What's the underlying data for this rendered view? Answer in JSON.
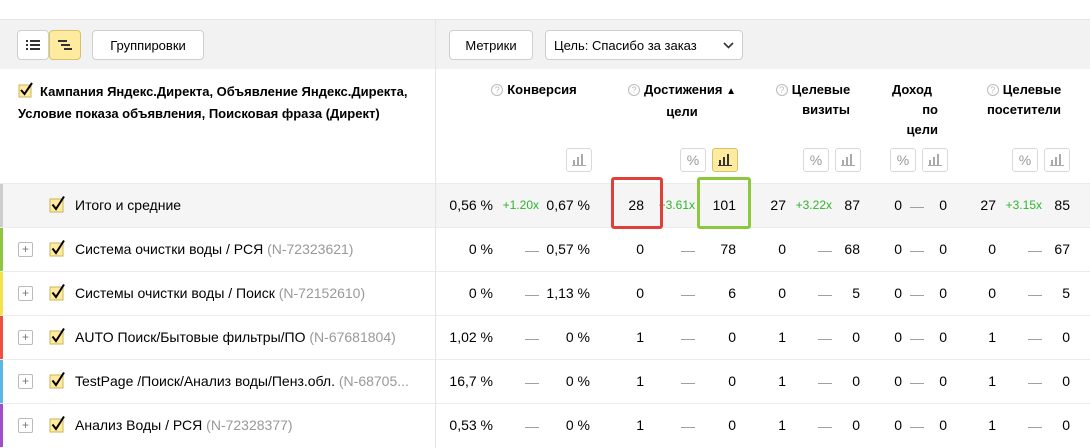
{
  "toolbar": {
    "view_list_icon": "list-view-icon",
    "view_tree_icon": "tree-view-icon",
    "groupings_label": "Группировки",
    "metrics_label": "Метрики",
    "goal_label": "Цель: Спасибо за заказ"
  },
  "header": {
    "main_title": "Кампания Яндекс.Директа, Объявление Яндекс.Директа, Условие показа объявления, Поисковая фраза (Директ)",
    "columns": {
      "conversion": "Конверсия",
      "goal_reaches_1": "Достижения",
      "goal_reaches_2": "цели",
      "sort_arrow": "▲",
      "target_visits_1": "Целевые",
      "target_visits_2": "визиты",
      "revenue_1": "Доход",
      "revenue_2": "по",
      "revenue_3": "цели",
      "target_visitors_1": "Целевые",
      "target_visitors_2": "посетители"
    }
  },
  "colors": {
    "accent_yellow": "#ffeba0",
    "delta_green": "#2db52d",
    "highlight_red": "#e0403a",
    "highlight_green": "#8dc63f"
  },
  "rows": [
    {
      "title": "Итого и средние",
      "id": "",
      "stripe": "#cccccc",
      "conv_a": "0,56 %",
      "conv_delta": "+1.20x",
      "conv_b": "0,67 %",
      "reach_a": "28",
      "reach_delta": "+3.61x",
      "reach_b": "101",
      "visits_a": "27",
      "visits_delta": "+3.22x",
      "visits_b": "87",
      "rev_a": "0",
      "rev_delta": "—",
      "rev_b": "0",
      "vis_a": "27",
      "vis_delta": "+3.15x",
      "vis_b": "85"
    },
    {
      "title": "Система очистки воды / РСЯ",
      "id": "(N-72323621)",
      "stripe": "#8dc63f",
      "conv_a": "0 %",
      "conv_delta": "—",
      "conv_b": "0,57 %",
      "reach_a": "0",
      "reach_delta": "—",
      "reach_b": "78",
      "visits_a": "0",
      "visits_delta": "—",
      "visits_b": "68",
      "rev_a": "0",
      "rev_delta": "—",
      "rev_b": "0",
      "vis_a": "0",
      "vis_delta": "—",
      "vis_b": "67"
    },
    {
      "title": "Системы очистки воды / Поиск",
      "id": "(N-72152610)",
      "stripe": "#f5e14a",
      "conv_a": "0 %",
      "conv_delta": "—",
      "conv_b": "1,13 %",
      "reach_a": "0",
      "reach_delta": "—",
      "reach_b": "6",
      "visits_a": "0",
      "visits_delta": "—",
      "visits_b": "5",
      "rev_a": "0",
      "rev_delta": "—",
      "rev_b": "0",
      "vis_a": "0",
      "vis_delta": "—",
      "vis_b": "5"
    },
    {
      "title": "AUTO Поиск/Бытовые фильтры/ПО",
      "id": "(N-67681804)",
      "stripe": "#f0503c",
      "conv_a": "1,02 %",
      "conv_delta": "—",
      "conv_b": "0 %",
      "reach_a": "1",
      "reach_delta": "—",
      "reach_b": "0",
      "visits_a": "1",
      "visits_delta": "—",
      "visits_b": "0",
      "rev_a": "0",
      "rev_delta": "—",
      "rev_b": "0",
      "vis_a": "1",
      "vis_delta": "—",
      "vis_b": "0"
    },
    {
      "title": "TestPage /Поиск/Анализ воды/Пенз.обл.",
      "id": "(N-68705...",
      "stripe": "#5bb8e6",
      "conv_a": "16,7 %",
      "conv_delta": "—",
      "conv_b": "0 %",
      "reach_a": "1",
      "reach_delta": "—",
      "reach_b": "0",
      "visits_a": "1",
      "visits_delta": "—",
      "visits_b": "0",
      "rev_a": "0",
      "rev_delta": "—",
      "rev_b": "0",
      "vis_a": "1",
      "vis_delta": "—",
      "vis_b": "0"
    },
    {
      "title": "Анализ Воды / РСЯ",
      "id": "(N-72328377)",
      "stripe": "#a04ec8",
      "conv_a": "0,53 %",
      "conv_delta": "—",
      "conv_b": "0 %",
      "reach_a": "1",
      "reach_delta": "—",
      "reach_b": "0",
      "visits_a": "1",
      "visits_delta": "—",
      "visits_b": "0",
      "rev_a": "0",
      "rev_delta": "—",
      "rev_b": "0",
      "vis_a": "1",
      "vis_delta": "—",
      "vis_b": "0"
    }
  ]
}
